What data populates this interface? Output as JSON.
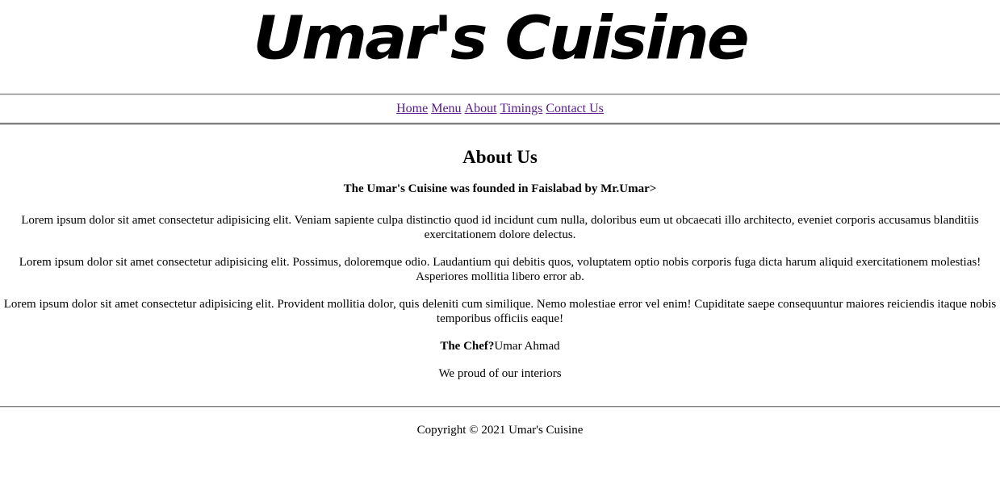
{
  "header": {
    "logo_text": "Umar's Cuisine"
  },
  "nav": {
    "items": [
      {
        "label": "Home"
      },
      {
        "label": "Menu"
      },
      {
        "label": "About"
      },
      {
        "label": "Timings"
      },
      {
        "label": "Contact Us"
      }
    ],
    "link_color": "#551a8b"
  },
  "main": {
    "heading": "About Us",
    "founded": "The Umar's Cuisine was founded in Faislabad by Mr.Umar>",
    "paragraphs": [
      "Lorem ipsum dolor sit amet consectetur adipisicing elit. Veniam sapiente culpa distinctio quod id incidunt cum nulla, doloribus eum ut obcaecati illo architecto, eveniet corporis accusamus blanditiis exercitationem dolore delectus.",
      "Lorem ipsum dolor sit amet consectetur adipisicing elit. Possimus, doloremque odio. Laudantium qui debitis quos, voluptatem optio nobis corporis fuga dicta harum aliquid exercitationem molestias! Asperiores mollitia libero error ab.",
      "Lorem ipsum dolor sit amet consectetur adipisicing elit. Provident mollitia dolor, quis deleniti cum similique. Nemo molestiae error vel enim! Cupiditate saepe consequuntur maiores reiciendis itaque nobis temporibus officiis eaque!"
    ],
    "chef_label": "The Chef?",
    "chef_name": "Umar Ahmad",
    "interiors": "We proud of our interiors"
  },
  "footer": {
    "copyright": "Copyright © 2021 Umar's Cuisine"
  }
}
